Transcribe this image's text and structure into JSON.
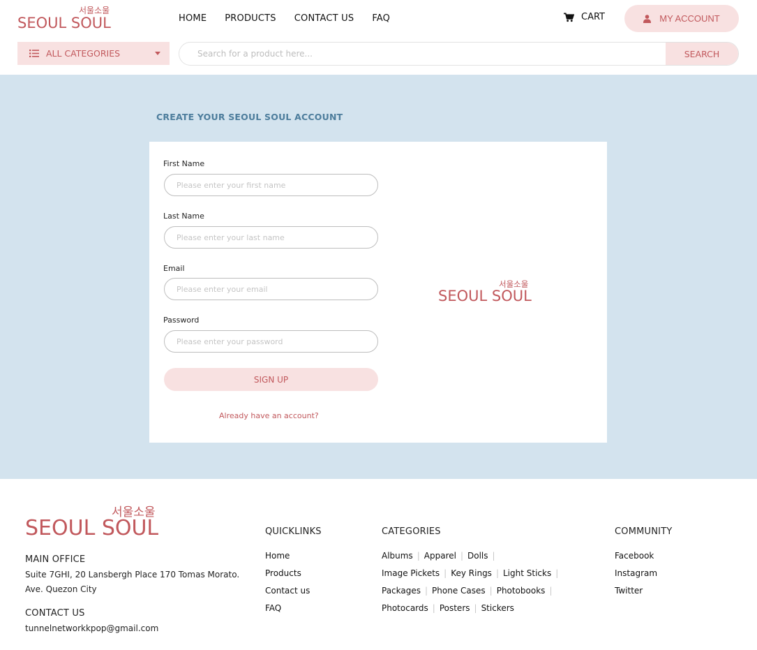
{
  "brand": {
    "name": "SEOUL SOUL",
    "korean": "서울소울",
    "color": "#c1585c"
  },
  "nav": {
    "items": [
      {
        "label": "HOME"
      },
      {
        "label": "PRODUCTS"
      },
      {
        "label": "CONTACT US"
      },
      {
        "label": "FAQ"
      }
    ],
    "cart_label": "CART",
    "cart_icon": "cart-icon",
    "account_label": "MY ACCOUNT",
    "account_icon": "user-icon"
  },
  "categories_select": {
    "label": "ALL CATEGORIES",
    "icon": "list-icon"
  },
  "search": {
    "placeholder": "Search for a product here...",
    "button_label": "SEARCH"
  },
  "form": {
    "title": "CREATE YOUR SEOUL SOUL ACCOUNT",
    "fields": [
      {
        "label": "First Name",
        "placeholder": "Please enter your first name"
      },
      {
        "label": "Last Name",
        "placeholder": "Please enter your last name"
      },
      {
        "label": "Email",
        "placeholder": "Please enter your email"
      },
      {
        "label": "Password",
        "placeholder": "Please enter your password"
      }
    ],
    "submit_label": "SIGN UP",
    "login_link": "Already have an account?"
  },
  "footer": {
    "main_office": {
      "heading": "MAIN OFFICE",
      "address_line1": "Suite 7GHI, 20 Lansbergh Place 170 Tomas Morato.",
      "address_line2": "Ave. Quezon City"
    },
    "contact": {
      "heading": "CONTACT US",
      "email": "tunnelnetworkkpop@gmail.com"
    },
    "quicklinks": {
      "heading": "QUICKLINKS",
      "items": [
        "Home",
        "Products",
        "Contact us",
        "FAQ"
      ]
    },
    "categories": {
      "heading": "CATEGORIES",
      "rows": [
        [
          "Albums",
          "Apparel",
          "Dolls"
        ],
        [
          "Image Pickets",
          "Key Rings",
          "Light Sticks"
        ],
        [
          "Packages",
          "Phone Cases",
          "Photobooks"
        ],
        [
          "Photocards",
          "Posters",
          "Stickers"
        ]
      ]
    },
    "community": {
      "heading": "COMMUNITY",
      "items": [
        "Facebook",
        "Instagram",
        "Twitter"
      ]
    }
  },
  "colors": {
    "accent": "#c1585c",
    "accent_bg": "#f8e1e1",
    "band_bg": "#d3e3ee",
    "title_blue": "#4d7d9c"
  }
}
